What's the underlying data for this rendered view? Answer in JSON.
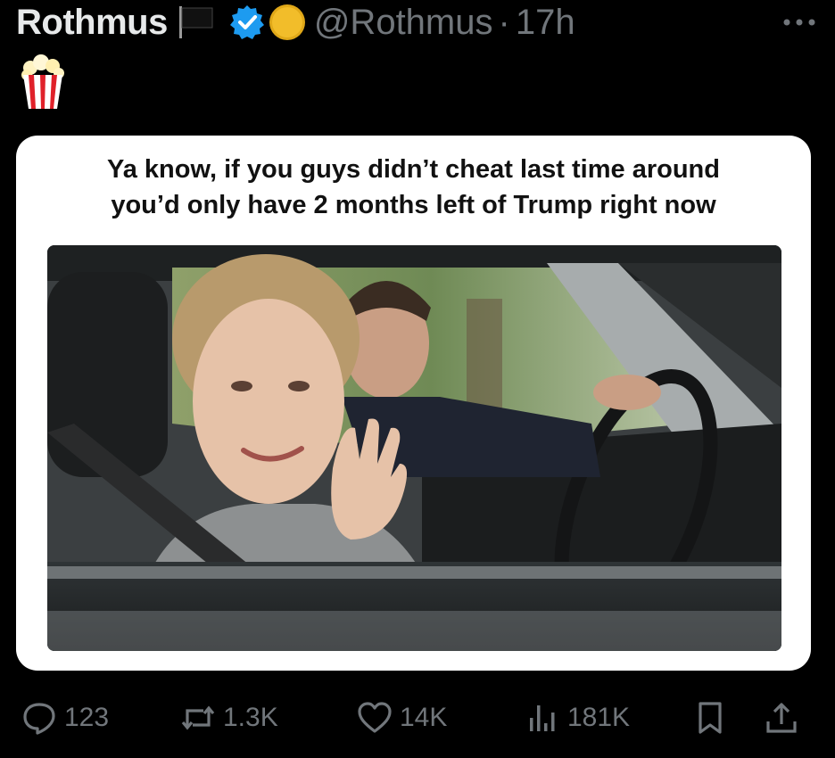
{
  "post": {
    "display_name": "Rothmus",
    "handle": "@Rothmus",
    "separator": "·",
    "time_ago": "17h",
    "badges": [
      "black-flag-icon",
      "verified-badge-icon",
      "gold-coin-icon"
    ],
    "extra_emoji": "popcorn-icon"
  },
  "media": {
    "caption_line1": "Ya know, if you guys didn’t cheat last time around",
    "caption_line2": "you’d only have 2 months left of Trump right now"
  },
  "actions": {
    "reply_count": "123",
    "repost_count": "1.3K",
    "like_count": "14K",
    "views_count": "181K"
  },
  "colors": {
    "background": "#000000",
    "text_primary": "#e7e9ea",
    "text_secondary": "#71767b",
    "verified": "#1d9bf0",
    "card": "#ffffff"
  }
}
